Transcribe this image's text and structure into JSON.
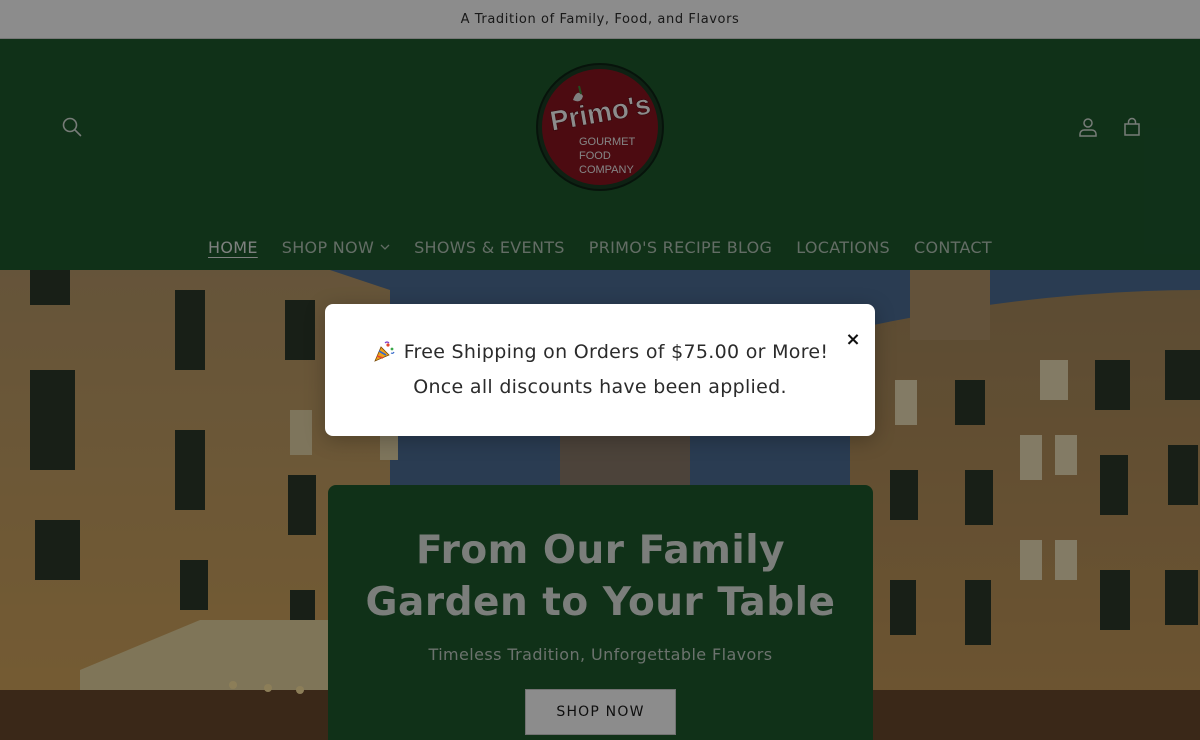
{
  "announcement": {
    "text": "A Tradition of Family, Food, and Flavors"
  },
  "header": {
    "logo": {
      "brand": "Primo's",
      "line1": "GOURMET",
      "line2": "FOOD",
      "line3": "COMPANY"
    },
    "icons": {
      "search": "search-icon",
      "account": "account-icon",
      "cart": "cart-icon"
    }
  },
  "nav": {
    "items": [
      {
        "label": "HOME",
        "active": true
      },
      {
        "label": "SHOP NOW",
        "dropdown": true
      },
      {
        "label": "SHOWS & EVENTS"
      },
      {
        "label": "PRIMO'S RECIPE BLOG"
      },
      {
        "label": "LOCATIONS"
      },
      {
        "label": "CONTACT"
      }
    ]
  },
  "hero": {
    "title_line1": "From Our Family",
    "title_line2": "Garden to Your Table",
    "subtitle": "Timeless Tradition, Unforgettable Flavors",
    "button_label": "SHOP NOW"
  },
  "popup": {
    "emoji": "party-popper-icon",
    "line1": "Free Shipping on Orders of $75.00 or More!",
    "line2": "Once all discounts have been applied.",
    "close_label": "×"
  },
  "colors": {
    "header_bg": "#1e5a2d",
    "logo_red": "#8b1420",
    "popup_bg": "#ffffff"
  }
}
